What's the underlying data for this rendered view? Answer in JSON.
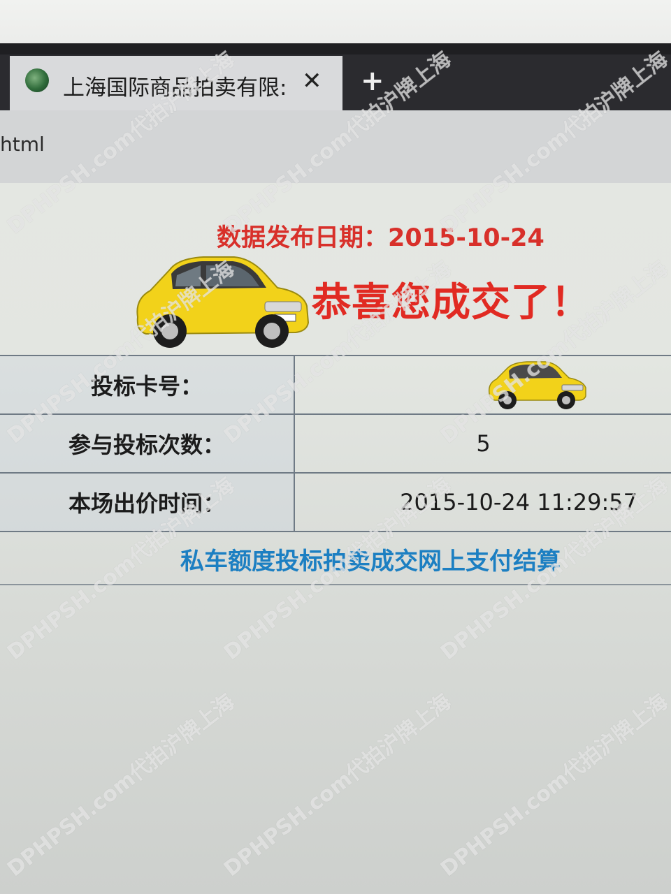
{
  "browser": {
    "tab_title": "上海国际商品拍卖有限:",
    "tab_close": "✕",
    "new_tab": "+",
    "url_text": "html",
    "tab_icon": "globe-icon"
  },
  "result": {
    "release_date_label": "数据发布日期：2015-10-24",
    "congrats_text": "恭喜您成交了！",
    "rows": [
      {
        "label": "投标卡号：",
        "value": ""
      },
      {
        "label": "参与投标次数：",
        "value": "5"
      },
      {
        "label": "本场出价时间：",
        "value": "2015-10-24 11:29:57"
      }
    ],
    "pay_link": "私车额度投标拍卖成交网上支付结算"
  },
  "watermark": {
    "text": "DPHPSH.com代拍沪牌上海"
  },
  "colors": {
    "date_red": "#d8302a",
    "congrats_red": "#e12a22",
    "link_blue": "#1c7fc2",
    "car_yellow": "#f2d21a"
  }
}
